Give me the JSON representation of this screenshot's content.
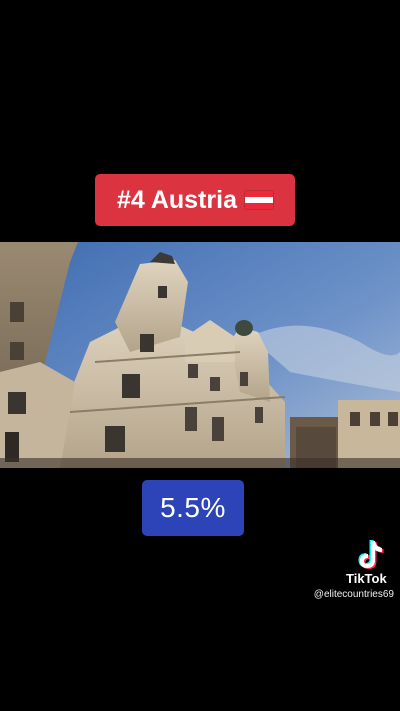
{
  "overlay": {
    "rank_title": "#4 Austria",
    "flag_icon": "austria-flag",
    "value": "5.5%"
  },
  "colors": {
    "title_badge": "#dc3340",
    "value_badge": "#2c44b8",
    "background": "#000000"
  },
  "watermark": {
    "app_name": "TikTok",
    "handle": "@elitecountries69"
  }
}
